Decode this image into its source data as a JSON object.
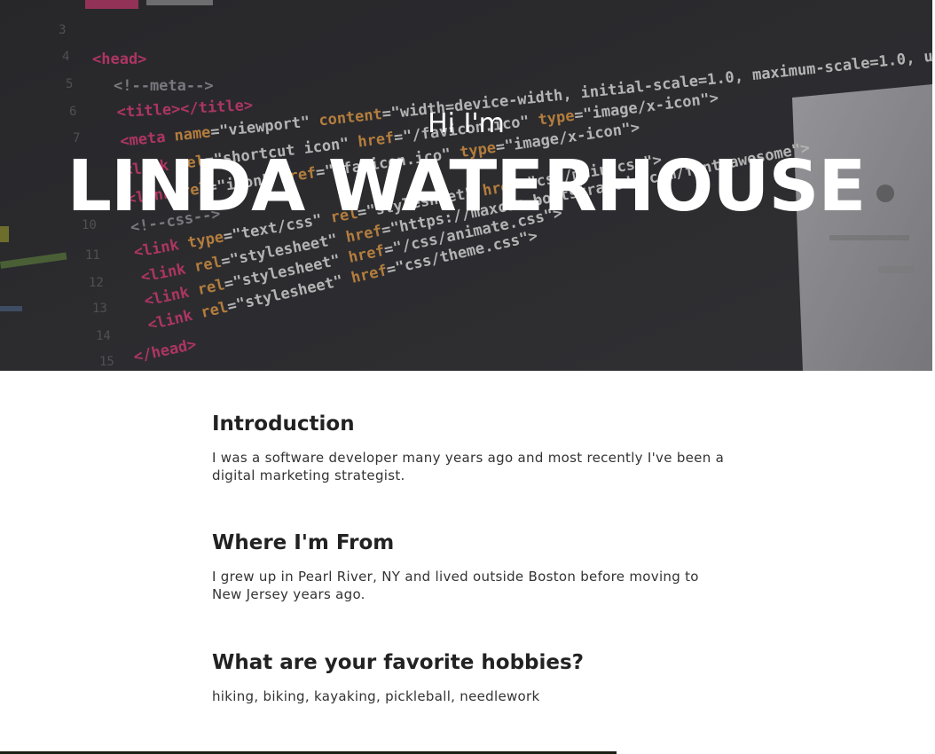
{
  "hero": {
    "greeting": "Hi I'm",
    "name": "LINDA WATERHOUSE",
    "background": "code-editor-photo"
  },
  "sections": [
    {
      "heading": "Introduction",
      "body": "I was a software developer many years ago and most recently I've been a digital marketing strategist."
    },
    {
      "heading": "Where I'm From",
      "body": "I grew up in Pearl River, NY and lived outside Boston before moving to New Jersey years ago."
    },
    {
      "heading": "What are your favorite hobbies?",
      "body": "hiking, biking, kayaking, pickleball, needlework"
    }
  ],
  "colors": {
    "text": "#222222",
    "hero_text": "#ffffff",
    "hero_bg": "#2b2b2e"
  }
}
